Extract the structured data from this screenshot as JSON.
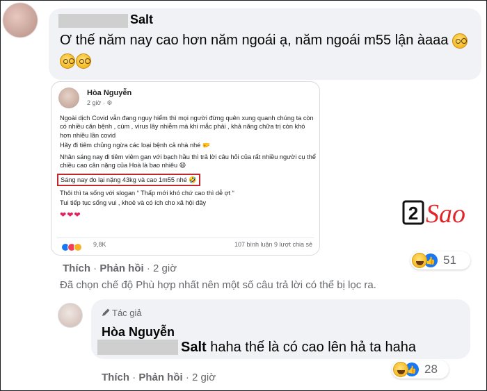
{
  "top_comment": {
    "author": "Salt",
    "text": "Ơ thế năm nay cao hơn năm ngoái ạ, năm ngoái m55 lận àaaa",
    "emoji_count": 3,
    "actions": {
      "like": "Thích",
      "reply": "Phản hồi",
      "time": "2 giờ"
    },
    "reactions_count": "51"
  },
  "embedded_post": {
    "author": "Hòa Nguyễn",
    "time": "2 giờ · ⚙",
    "paragraphs": [
      "Ngoài dịch Covid vẫn đang nguy hiểm thì mọi người đừng quên xung quanh chúng ta còn có nhiều căn bệnh , cúm , virus lây nhiễm mà khi mắc phải , khả năng chữa trị còn khó hơn nhiều lần covid",
      "Hãy đi tiêm chủng ngừa các loại bệnh cả nhà nhé 🤛",
      "Nhân sáng nay đi tiêm viêm gan với bạch hầu thì trả lời câu hỏi của rất nhiều người cụ thể chiều cao cân nặng của Hoà là bao nhiêu 😄"
    ],
    "highlight": "Sáng nay đo lại nặng 43kg và cao 1m55 nhé 🤣",
    "slogan": "Thôi thì ta sống với slogan “ Thấp mới khó chứ cao thì dễ ợt “",
    "closing": "Tui tiếp tục sống vui , khoẻ và có ích cho xã hội đây",
    "hearts": "❤❤❤",
    "reactions": "9,8K",
    "stats": "107 bình luận  9 lượt chia sẻ"
  },
  "watermark": {
    "digit": "2",
    "word": "Sao"
  },
  "filter_note": "Đã chọn chế độ Phù hợp nhất nên một số câu trả lời có thể bị lọc ra.",
  "reply": {
    "badge": "Tác giả",
    "author": "Hòa Nguyễn",
    "mention": "Salt",
    "text": " haha thế là có cao lên hả ta haha",
    "actions": {
      "like": "Thích",
      "reply": "Phản hồi",
      "time": "2 giờ"
    },
    "reactions_count": "28"
  },
  "colors": {
    "bubble": "#f0f2f5",
    "muted": "#65676b",
    "highlight_border": "#c0282c",
    "like_blue": "#1877f2"
  }
}
